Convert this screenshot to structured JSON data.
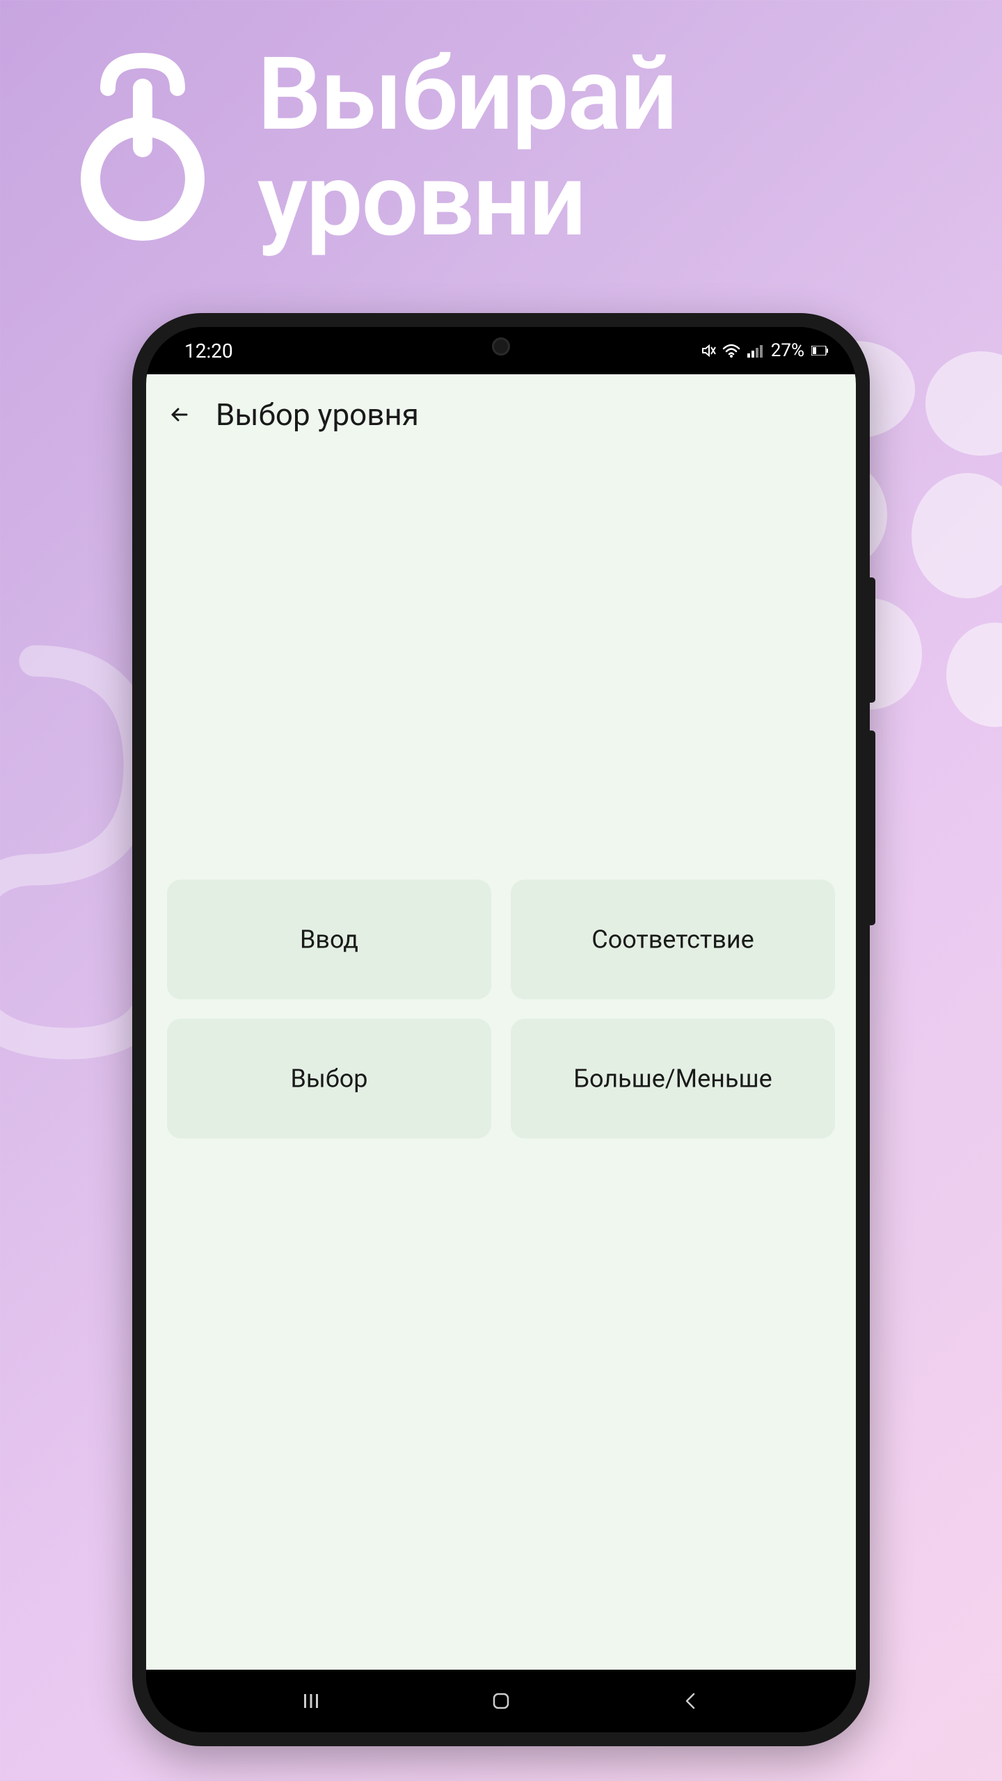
{
  "header": {
    "line1": "Выбирай",
    "line2": "уровни"
  },
  "status_bar": {
    "time": "12:20",
    "battery": "27%"
  },
  "app": {
    "title": "Выбор уровня",
    "levels": [
      "Ввод",
      "Соответствие",
      "Выбор",
      "Больше/Меньше"
    ]
  }
}
